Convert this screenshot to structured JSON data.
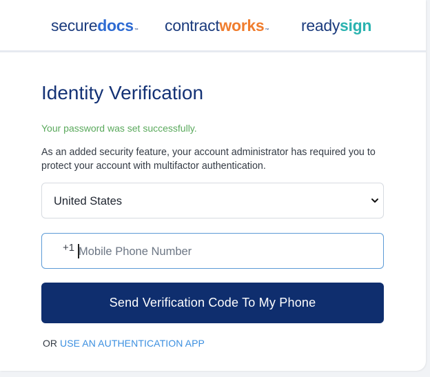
{
  "brands": [
    {
      "part1": "secure",
      "part2": "docs",
      "tm": "™"
    },
    {
      "part1": "contract",
      "part2": "works",
      "tm": "™"
    },
    {
      "part1": "ready",
      "part2": "sign"
    }
  ],
  "page": {
    "title": "Identity Verification",
    "success_message": "Your password was set successfully.",
    "description": "As an added security feature, your account administrator has required you to protect your account with multifactor authentication."
  },
  "country_select": {
    "selected": "United States"
  },
  "phone": {
    "prefix": "+1",
    "placeholder": "Mobile Phone Number",
    "value": ""
  },
  "send_button_label": "Send Verification Code To My Phone",
  "alt": {
    "or_label": "OR",
    "link_label": "USE AN AUTHENTICATION APP"
  },
  "colors": {
    "primary_navy": "#0f2e6e",
    "title_blue": "#143275",
    "success_green": "#5aa95c",
    "link_blue": "#3b8fe0",
    "securedocs_accent": "#2e6bd2",
    "contractworks_accent": "#f07d2e",
    "readysign_accent": "#2bb3b0"
  },
  "icons": {
    "select_chevron": "chevron-down-icon"
  }
}
